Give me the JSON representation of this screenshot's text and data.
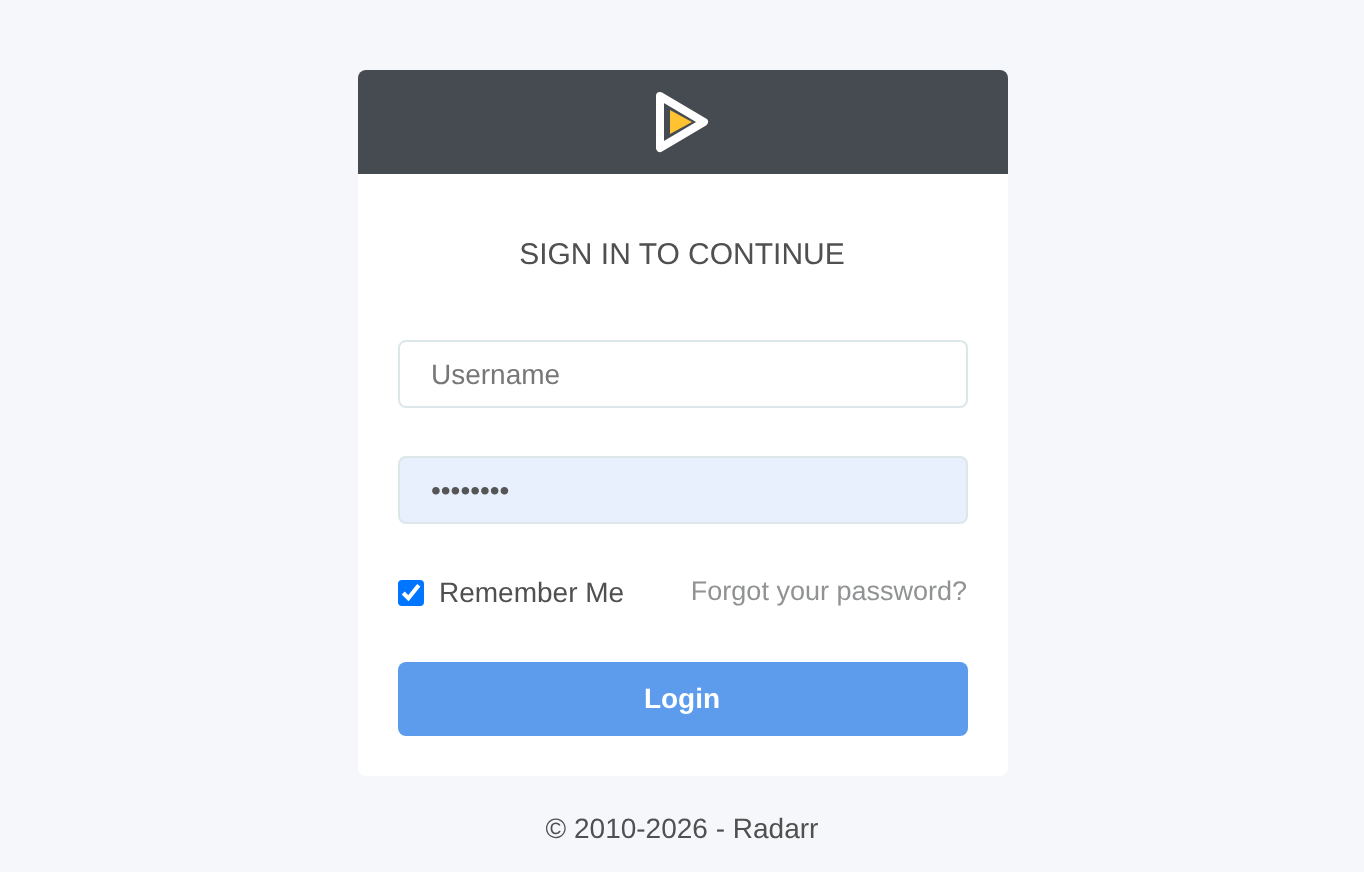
{
  "title": "SIGN IN TO CONTINUE",
  "username": {
    "placeholder": "Username"
  },
  "password": {
    "value": "••••••••",
    "autofilled": true
  },
  "remember": {
    "label": "Remember Me",
    "checked": true
  },
  "forgot_link": "Forgot your password?",
  "login_button": "Login",
  "footer": "© 2010-2026 - Radarr"
}
